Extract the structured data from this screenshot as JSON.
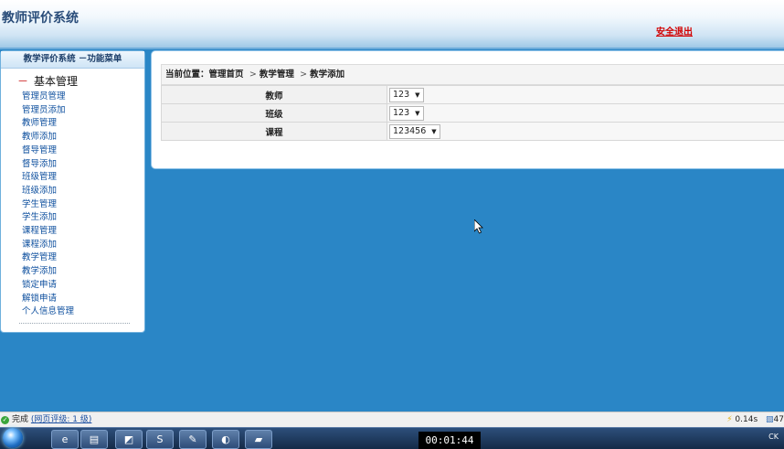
{
  "app": {
    "title": "教师评价系统",
    "logout_label": "安全退出"
  },
  "sidebar": {
    "header": "教学评价系统  －功能菜单",
    "section_title": "基本管理",
    "items": [
      "管理员管理",
      "管理员添加",
      "教师管理",
      "教师添加",
      "督导管理",
      "督导添加",
      "班级管理",
      "班级添加",
      "学生管理",
      "学生添加",
      "课程管理",
      "课程添加",
      "教学管理",
      "教学添加",
      "锁定申请",
      "解锁申请",
      "个人信息管理"
    ]
  },
  "breadcrumb": {
    "prefix": "当前位置：",
    "items": [
      "管理首页",
      "教学管理",
      "教学添加"
    ],
    "separator": ">"
  },
  "form": {
    "fields": [
      {
        "label": "教师",
        "value": "123"
      },
      {
        "label": "班级",
        "value": "123"
      },
      {
        "label": "课程",
        "value": "123456"
      }
    ]
  },
  "statusbar": {
    "status": "完成",
    "rating": "(网页评级: 1 级)",
    "time": "0.14s",
    "extra": "47"
  },
  "taskbar": {
    "clock": "00:01:44",
    "lang": "CK"
  }
}
